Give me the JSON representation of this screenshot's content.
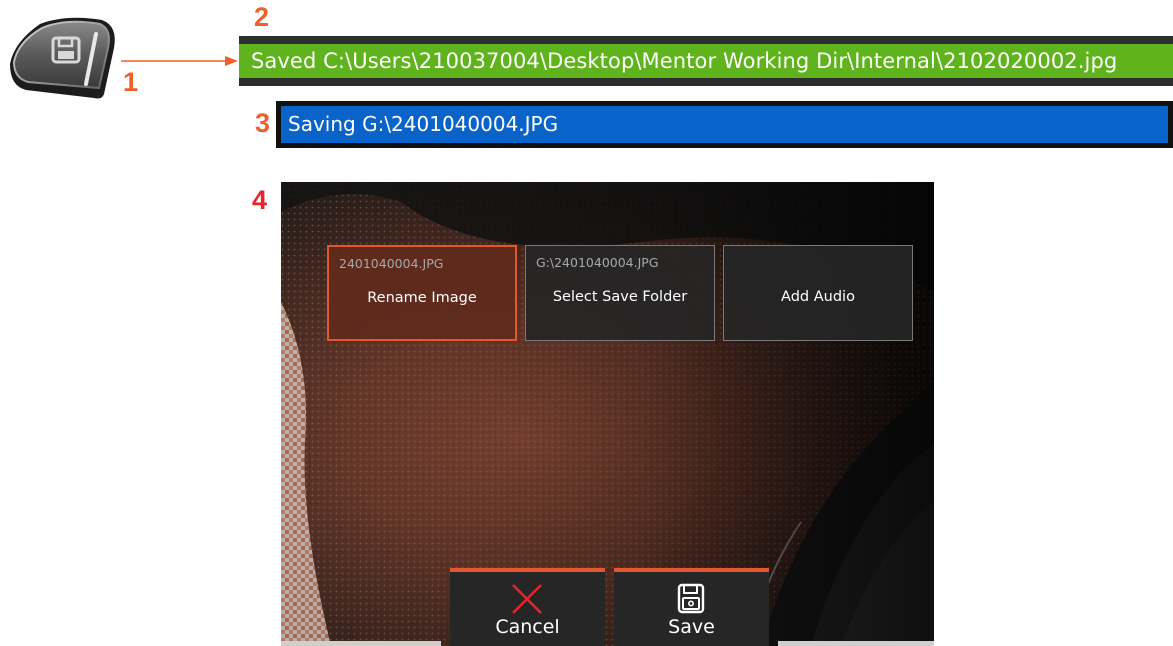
{
  "callouts": [
    "1",
    "2",
    "3",
    "4"
  ],
  "colors": {
    "callout_orange": "#f0602a",
    "callout_red": "#e8232a",
    "saved_bar_green": "#5fb31c",
    "saving_bar_blue": "#0a63c9",
    "accent": "#e4572e"
  },
  "hardware_key": {
    "icon": "floppy-disk-icon"
  },
  "saved_status": {
    "text": "Saved C:\\Users\\210037004\\Desktop\\Mentor Working Dir\\Internal\\2102020002.jpg"
  },
  "saving_status": {
    "text": "Saving G:\\2401040004.JPG"
  },
  "save_menu": {
    "options": [
      {
        "sublabel": "2401040004.JPG",
        "label": "Rename Image",
        "selected": true
      },
      {
        "sublabel": "G:\\2401040004.JPG",
        "label": "Select Save Folder",
        "selected": false
      },
      {
        "sublabel": "",
        "label": "Add Audio",
        "selected": false
      }
    ],
    "cancel": {
      "label": "Cancel",
      "icon": "close-x-icon"
    },
    "save": {
      "label": "Save",
      "icon": "floppy-disk-icon"
    }
  }
}
